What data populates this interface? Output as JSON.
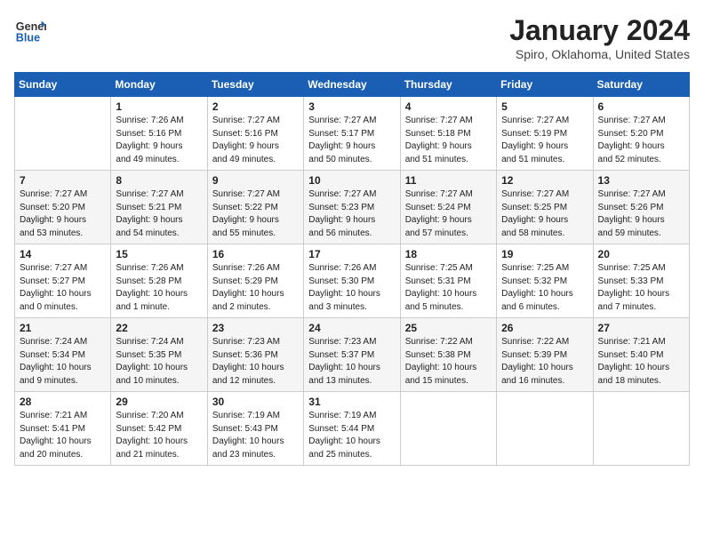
{
  "header": {
    "logo_line1": "General",
    "logo_line2": "Blue",
    "month": "January 2024",
    "location": "Spiro, Oklahoma, United States"
  },
  "days_of_week": [
    "Sunday",
    "Monday",
    "Tuesday",
    "Wednesday",
    "Thursday",
    "Friday",
    "Saturday"
  ],
  "weeks": [
    [
      {
        "day": "",
        "sunrise": "",
        "sunset": "",
        "daylight": ""
      },
      {
        "day": "1",
        "sunrise": "7:26 AM",
        "sunset": "5:16 PM",
        "daylight_hours": "9 hours",
        "daylight_mins": "and 49 minutes."
      },
      {
        "day": "2",
        "sunrise": "7:27 AM",
        "sunset": "5:16 PM",
        "daylight_hours": "9 hours",
        "daylight_mins": "and 49 minutes."
      },
      {
        "day": "3",
        "sunrise": "7:27 AM",
        "sunset": "5:17 PM",
        "daylight_hours": "9 hours",
        "daylight_mins": "and 50 minutes."
      },
      {
        "day": "4",
        "sunrise": "7:27 AM",
        "sunset": "5:18 PM",
        "daylight_hours": "9 hours",
        "daylight_mins": "and 51 minutes."
      },
      {
        "day": "5",
        "sunrise": "7:27 AM",
        "sunset": "5:19 PM",
        "daylight_hours": "9 hours",
        "daylight_mins": "and 51 minutes."
      },
      {
        "day": "6",
        "sunrise": "7:27 AM",
        "sunset": "5:20 PM",
        "daylight_hours": "9 hours",
        "daylight_mins": "and 52 minutes."
      }
    ],
    [
      {
        "day": "7",
        "sunrise": "7:27 AM",
        "sunset": "5:20 PM",
        "daylight_hours": "9 hours",
        "daylight_mins": "and 53 minutes."
      },
      {
        "day": "8",
        "sunrise": "7:27 AM",
        "sunset": "5:21 PM",
        "daylight_hours": "9 hours",
        "daylight_mins": "and 54 minutes."
      },
      {
        "day": "9",
        "sunrise": "7:27 AM",
        "sunset": "5:22 PM",
        "daylight_hours": "9 hours",
        "daylight_mins": "and 55 minutes."
      },
      {
        "day": "10",
        "sunrise": "7:27 AM",
        "sunset": "5:23 PM",
        "daylight_hours": "9 hours",
        "daylight_mins": "and 56 minutes."
      },
      {
        "day": "11",
        "sunrise": "7:27 AM",
        "sunset": "5:24 PM",
        "daylight_hours": "9 hours",
        "daylight_mins": "and 57 minutes."
      },
      {
        "day": "12",
        "sunrise": "7:27 AM",
        "sunset": "5:25 PM",
        "daylight_hours": "9 hours",
        "daylight_mins": "and 58 minutes."
      },
      {
        "day": "13",
        "sunrise": "7:27 AM",
        "sunset": "5:26 PM",
        "daylight_hours": "9 hours",
        "daylight_mins": "and 59 minutes."
      }
    ],
    [
      {
        "day": "14",
        "sunrise": "7:27 AM",
        "sunset": "5:27 PM",
        "daylight_hours": "10 hours",
        "daylight_mins": "and 0 minutes."
      },
      {
        "day": "15",
        "sunrise": "7:26 AM",
        "sunset": "5:28 PM",
        "daylight_hours": "10 hours",
        "daylight_mins": "and 1 minute."
      },
      {
        "day": "16",
        "sunrise": "7:26 AM",
        "sunset": "5:29 PM",
        "daylight_hours": "10 hours",
        "daylight_mins": "and 2 minutes."
      },
      {
        "day": "17",
        "sunrise": "7:26 AM",
        "sunset": "5:30 PM",
        "daylight_hours": "10 hours",
        "daylight_mins": "and 3 minutes."
      },
      {
        "day": "18",
        "sunrise": "7:25 AM",
        "sunset": "5:31 PM",
        "daylight_hours": "10 hours",
        "daylight_mins": "and 5 minutes."
      },
      {
        "day": "19",
        "sunrise": "7:25 AM",
        "sunset": "5:32 PM",
        "daylight_hours": "10 hours",
        "daylight_mins": "and 6 minutes."
      },
      {
        "day": "20",
        "sunrise": "7:25 AM",
        "sunset": "5:33 PM",
        "daylight_hours": "10 hours",
        "daylight_mins": "and 7 minutes."
      }
    ],
    [
      {
        "day": "21",
        "sunrise": "7:24 AM",
        "sunset": "5:34 PM",
        "daylight_hours": "10 hours",
        "daylight_mins": "and 9 minutes."
      },
      {
        "day": "22",
        "sunrise": "7:24 AM",
        "sunset": "5:35 PM",
        "daylight_hours": "10 hours",
        "daylight_mins": "and 10 minutes."
      },
      {
        "day": "23",
        "sunrise": "7:23 AM",
        "sunset": "5:36 PM",
        "daylight_hours": "10 hours",
        "daylight_mins": "and 12 minutes."
      },
      {
        "day": "24",
        "sunrise": "7:23 AM",
        "sunset": "5:37 PM",
        "daylight_hours": "10 hours",
        "daylight_mins": "and 13 minutes."
      },
      {
        "day": "25",
        "sunrise": "7:22 AM",
        "sunset": "5:38 PM",
        "daylight_hours": "10 hours",
        "daylight_mins": "and 15 minutes."
      },
      {
        "day": "26",
        "sunrise": "7:22 AM",
        "sunset": "5:39 PM",
        "daylight_hours": "10 hours",
        "daylight_mins": "and 16 minutes."
      },
      {
        "day": "27",
        "sunrise": "7:21 AM",
        "sunset": "5:40 PM",
        "daylight_hours": "10 hours",
        "daylight_mins": "and 18 minutes."
      }
    ],
    [
      {
        "day": "28",
        "sunrise": "7:21 AM",
        "sunset": "5:41 PM",
        "daylight_hours": "10 hours",
        "daylight_mins": "and 20 minutes."
      },
      {
        "day": "29",
        "sunrise": "7:20 AM",
        "sunset": "5:42 PM",
        "daylight_hours": "10 hours",
        "daylight_mins": "and 21 minutes."
      },
      {
        "day": "30",
        "sunrise": "7:19 AM",
        "sunset": "5:43 PM",
        "daylight_hours": "10 hours",
        "daylight_mins": "and 23 minutes."
      },
      {
        "day": "31",
        "sunrise": "7:19 AM",
        "sunset": "5:44 PM",
        "daylight_hours": "10 hours",
        "daylight_mins": "and 25 minutes."
      },
      {
        "day": "",
        "sunrise": "",
        "sunset": "",
        "daylight_hours": "",
        "daylight_mins": ""
      },
      {
        "day": "",
        "sunrise": "",
        "sunset": "",
        "daylight_hours": "",
        "daylight_mins": ""
      },
      {
        "day": "",
        "sunrise": "",
        "sunset": "",
        "daylight_hours": "",
        "daylight_mins": ""
      }
    ]
  ]
}
